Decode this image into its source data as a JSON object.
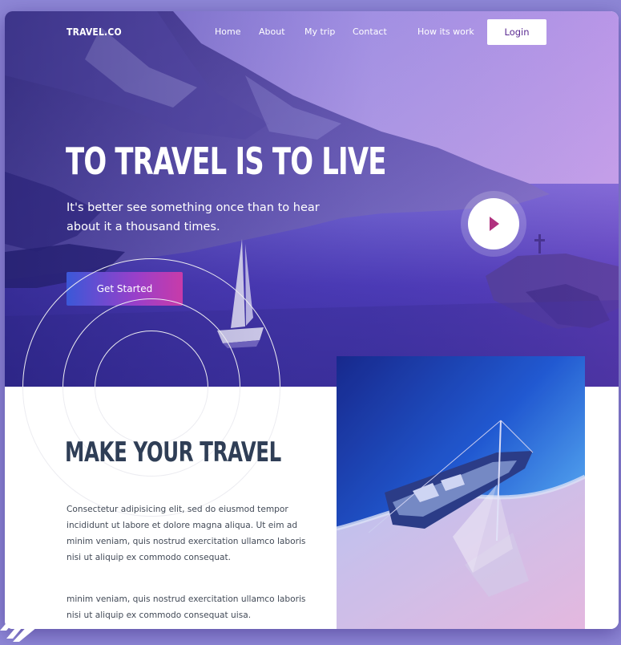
{
  "nav": {
    "brand": "TRAVEL.CO",
    "links": [
      "Home",
      "About",
      "My trip",
      "Contact",
      "How its work"
    ],
    "login_label": "Login"
  },
  "hero": {
    "title": "TO TRAVEL IS TO LIVE",
    "subtitle": "It's better see something once than to hear about it a thousand times.",
    "cta_label": "Get Started"
  },
  "section": {
    "title": "MAKE YOUR TRAVEL",
    "paragraphs": [
      "Consectetur adipisicing elit, sed do eiusmod tempor incididunt ut labore et dolore magna aliqua. Ut eim ad minim veniam, quis nostrud exercitation ullamco laboris nisi ut aliquip ex commodo consequat.",
      "minim veniam, quis nostrud exercitation ullamco laboris nisi ut aliquip ex commodo consequat uisa."
    ]
  },
  "icons": {
    "play": "play-icon",
    "corner_logo": "stripes-logo-icon"
  },
  "colors": {
    "accent": "#b0327f",
    "cta_gradient_start": "#3b58d8",
    "cta_gradient_end": "#c83ba9",
    "heading": "#2f3e56",
    "background": "#8e87d6"
  }
}
